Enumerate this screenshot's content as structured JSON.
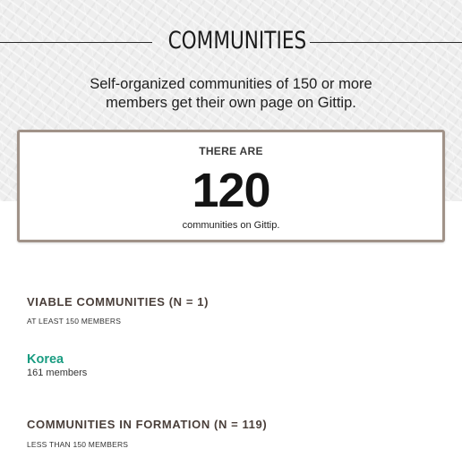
{
  "header": {
    "title": "COMMUNITIES",
    "lead": "Self-organized communities of 150 or more members get their own page on Gittip."
  },
  "stat": {
    "kicker": "THERE ARE",
    "number": "120",
    "caption": "communities on Gittip."
  },
  "viable": {
    "title": "VIABLE COMMUNITIES (N = 1)",
    "subtitle": "AT LEAST 150 MEMBERS",
    "items": [
      {
        "name": "Korea",
        "members": "161 members"
      }
    ]
  },
  "forming": {
    "title": "COMMUNITIES IN FORMATION (N = 119)",
    "subtitle": "LESS THAN 150 MEMBERS"
  },
  "colors": {
    "accent": "#199c81",
    "box_border": "#a09288",
    "section_title": "#4a3f3a"
  }
}
